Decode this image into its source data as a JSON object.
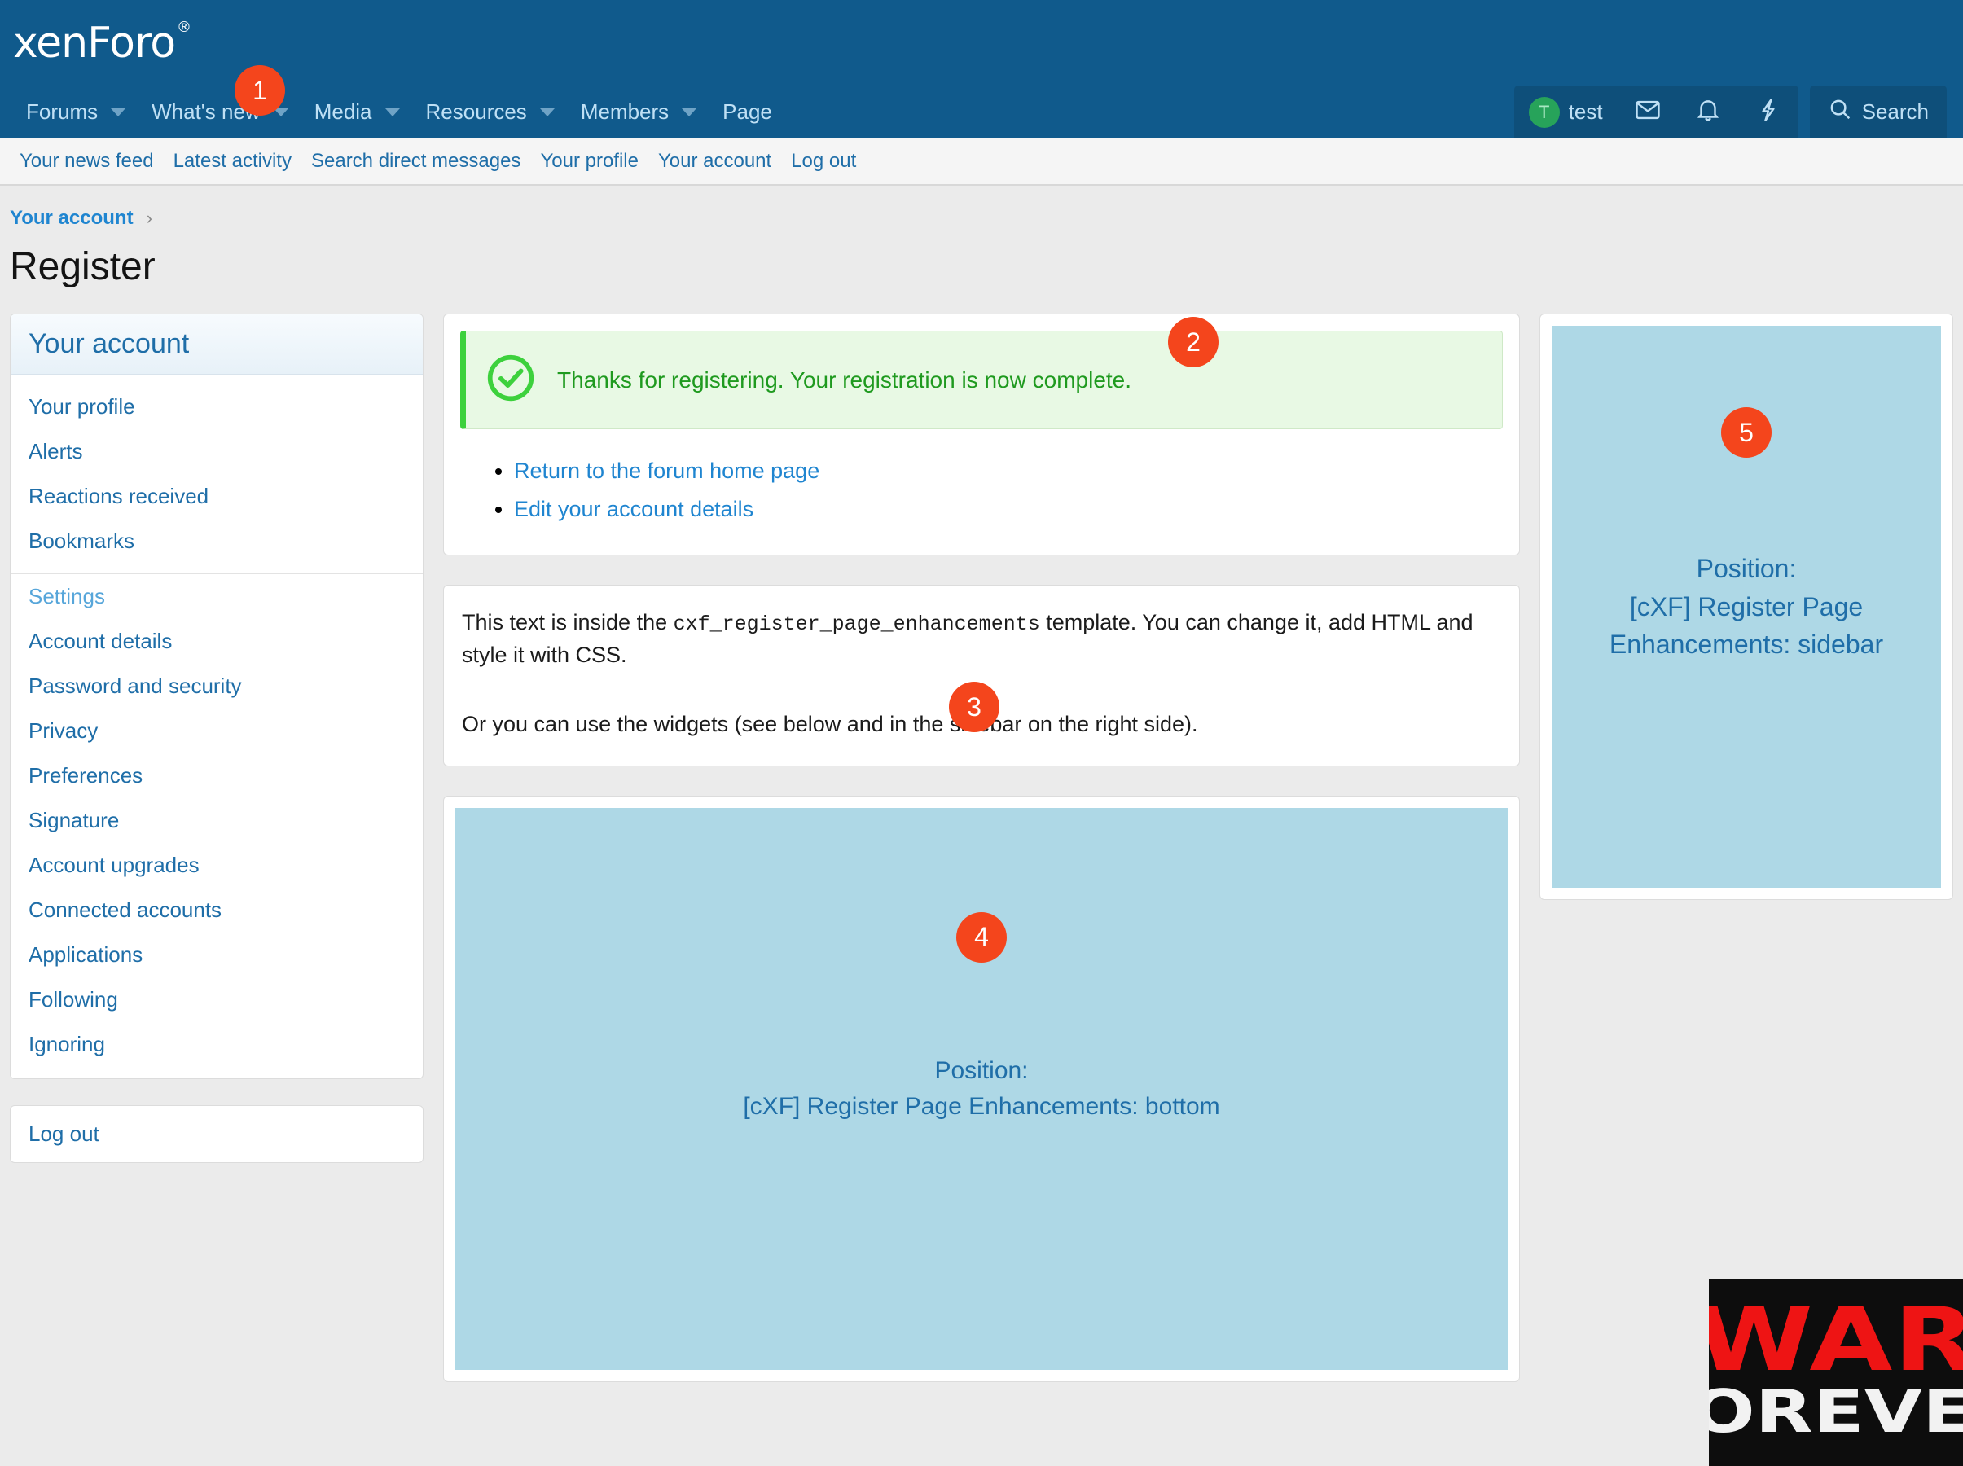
{
  "brand": {
    "logo_text": "xenForo",
    "logo_registered": "®"
  },
  "mainnav": {
    "items": [
      {
        "label": "Forums",
        "has_dropdown": true
      },
      {
        "label": "What's new",
        "has_dropdown": true
      },
      {
        "label": "Media",
        "has_dropdown": true
      },
      {
        "label": "Resources",
        "has_dropdown": true
      },
      {
        "label": "Members",
        "has_dropdown": true
      },
      {
        "label": "Page",
        "has_dropdown": false
      }
    ],
    "visitor": {
      "avatar_initial": "T",
      "username": "test",
      "icons": [
        "envelope-icon",
        "bell-icon",
        "bolt-icon"
      ]
    },
    "search_label": "Search"
  },
  "subnav": {
    "items": [
      "Your news feed",
      "Latest activity",
      "Search direct messages",
      "Your profile",
      "Your account",
      "Log out"
    ]
  },
  "breadcrumb": {
    "items": [
      "Your account"
    ],
    "separator": "›"
  },
  "page": {
    "title": "Register"
  },
  "sidebar": {
    "header": "Your account",
    "items": [
      {
        "label": "Your profile",
        "type": "link"
      },
      {
        "label": "Alerts",
        "type": "link"
      },
      {
        "label": "Reactions received",
        "type": "link"
      },
      {
        "label": "Bookmarks",
        "type": "link"
      },
      {
        "label": "Settings",
        "type": "subheader"
      },
      {
        "label": "Account details",
        "type": "link"
      },
      {
        "label": "Password and security",
        "type": "link"
      },
      {
        "label": "Privacy",
        "type": "link"
      },
      {
        "label": "Preferences",
        "type": "link"
      },
      {
        "label": "Signature",
        "type": "link"
      },
      {
        "label": "Account upgrades",
        "type": "link"
      },
      {
        "label": "Connected accounts",
        "type": "link"
      },
      {
        "label": "Applications",
        "type": "link"
      },
      {
        "label": "Following",
        "type": "link"
      },
      {
        "label": "Ignoring",
        "type": "link"
      }
    ],
    "logout_label": "Log out"
  },
  "main": {
    "alert": {
      "icon": "check-circle-icon",
      "message": "Thanks for registering. Your registration is now complete."
    },
    "links": [
      "Return to the forum home page",
      "Edit your account details"
    ],
    "template_text": {
      "line1_part1": "This text is inside the ",
      "line1_code": "cxf_register_page_enhancements",
      "line1_part2": " template. You can change it, add HTML and style it with CSS.",
      "line2": "Or you can use the widgets (see below and in the sidebar on the right side)."
    }
  },
  "widgets": {
    "bottom": {
      "label": "Position:",
      "position_name": "[cXF] Register Page Enhancements: bottom"
    },
    "sidebar": {
      "label": "Position:",
      "position_name": "[cXF] Register Page Enhancements: sidebar"
    }
  },
  "badges": {
    "one": "1",
    "two": "2",
    "three": "3",
    "four": "4",
    "five": "5"
  },
  "banner": {
    "line1": "WAR",
    "line2": "FOREVER"
  },
  "colors": {
    "header_blue": "#105a8c",
    "link_blue": "#1f6ea8",
    "success_green": "#1f9a1f",
    "badge_orange": "#f4451c",
    "widget_blue": "#aed8e6",
    "banner_red": "#ee1414"
  }
}
